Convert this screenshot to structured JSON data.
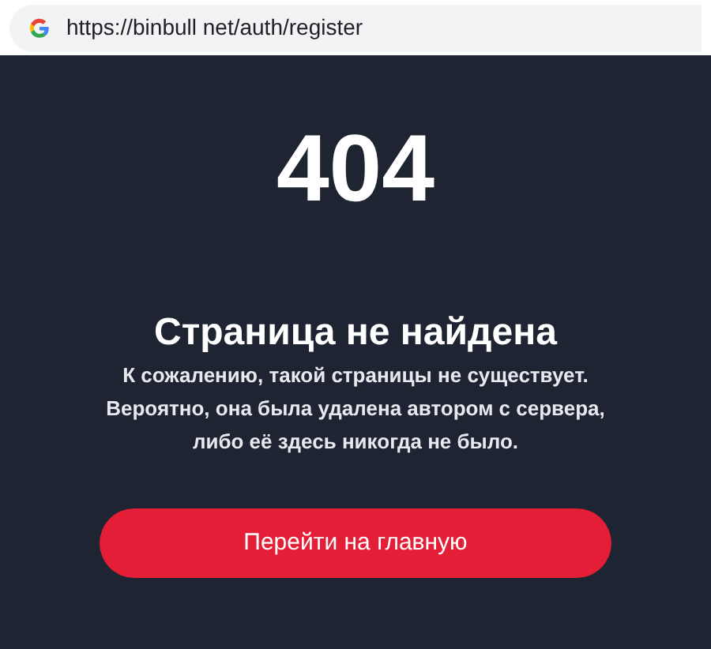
{
  "address_bar": {
    "url": "https://binbull net/auth/register"
  },
  "error": {
    "code": "404",
    "title": "Страница не найдена",
    "message": "К сожалению, такой страницы не существует. Вероятно, она была удалена автором с сервера, либо её здесь никогда не было."
  },
  "button": {
    "label": "Перейти на главную"
  }
}
